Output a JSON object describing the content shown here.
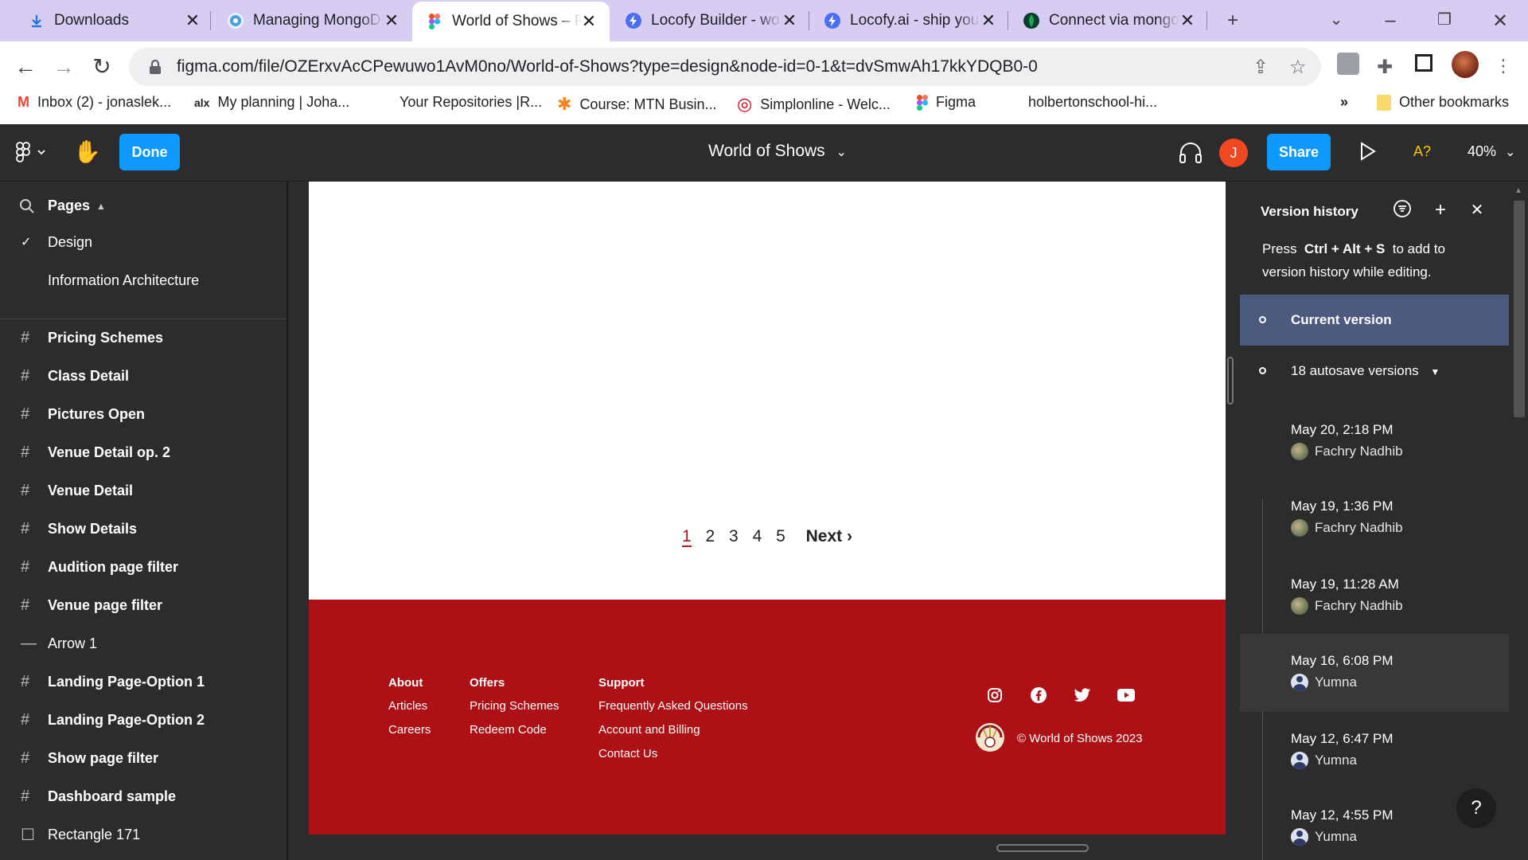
{
  "browser": {
    "tabs": [
      {
        "title": "Downloads",
        "icon": "download-icon"
      },
      {
        "title": "Managing MongoDB",
        "icon": "mongodb-atlas-icon"
      },
      {
        "title": "World of Shows – Figma",
        "icon": "figma-icon",
        "active": true
      },
      {
        "title": "Locofy Builder - wo",
        "icon": "locofy-icon"
      },
      {
        "title": "Locofy.ai - ship you",
        "icon": "locofy-icon"
      },
      {
        "title": "Connect via mongo",
        "icon": "mongodb-leaf-icon"
      }
    ],
    "new_tab": "+",
    "url": "figma.com/file/OZErxvAcCPewuwo1AvM0no/World-of-Shows?type=design&node-id=0-1&t=dvSmwAh17kkYDQB0-0",
    "bookmarks": [
      {
        "label": "Inbox (2) - jonaslek...",
        "icon": "M"
      },
      {
        "label": "My planning | Joha...",
        "icon": "alx"
      },
      {
        "label": "Your Repositories |R...",
        "icon": ""
      },
      {
        "label": "Course: MTN Busin...",
        "icon": "✱"
      },
      {
        "label": "Simplonline - Welc...",
        "icon": "◎"
      },
      {
        "label": "Figma",
        "icon": "figma"
      },
      {
        "label": "holbertonschool-hi...",
        "icon": ""
      }
    ],
    "bookmarks_overflow": "»",
    "other_bookmarks": "Other bookmarks"
  },
  "figma": {
    "done_label": "Done",
    "file_title": "World of Shows",
    "share_label": "Share",
    "avatar_initial": "J",
    "a11y_label": "A?",
    "zoom": "40%",
    "pages_label": "Pages",
    "pages": [
      {
        "label": "Design",
        "selected": true
      },
      {
        "label": "Information Architecture",
        "selected": false
      }
    ],
    "layers": [
      {
        "label": "Pricing Schemes",
        "icon": "#"
      },
      {
        "label": "Class Detail",
        "icon": "#"
      },
      {
        "label": "Pictures Open",
        "icon": "#"
      },
      {
        "label": "Venue Detail op. 2",
        "icon": "#"
      },
      {
        "label": "Venue Detail",
        "icon": "#"
      },
      {
        "label": "Show Details",
        "icon": "#"
      },
      {
        "label": "Audition page filter",
        "icon": "#"
      },
      {
        "label": "Venue page filter",
        "icon": "#"
      },
      {
        "label": "Arrow 1",
        "icon": "—"
      },
      {
        "label": "Landing Page-Option 1",
        "icon": "#"
      },
      {
        "label": "Landing Page-Option 2",
        "icon": "#"
      },
      {
        "label": "Show page filter",
        "icon": "#"
      },
      {
        "label": "Dashboard sample",
        "icon": "#"
      },
      {
        "label": "Rectangle 171",
        "icon": "☐"
      }
    ]
  },
  "canvas": {
    "pagination": {
      "pages": [
        "1",
        "2",
        "3",
        "4",
        "5"
      ],
      "current": "1",
      "next": "Next"
    },
    "footer": {
      "about": {
        "head": "About",
        "items": [
          "Articles",
          "Careers"
        ]
      },
      "offers": {
        "head": "Offers",
        "items": [
          "Pricing Schemes",
          "Redeem Code"
        ]
      },
      "support": {
        "head": "Support",
        "items": [
          "Frequently Asked Questions",
          "Account and Billing",
          "Contact Us"
        ]
      },
      "copyright": "© World of Shows 2023",
      "socials": [
        "instagram-icon",
        "facebook-icon",
        "twitter-icon",
        "youtube-icon"
      ]
    }
  },
  "version_history": {
    "title": "Version history",
    "hint_press": "Press",
    "hint_keys": "Ctrl + Alt + S",
    "hint_rest": "to add to version history while editing.",
    "current_version": "Current version",
    "autosave": "18 autosave versions",
    "versions": [
      {
        "date": "May 20, 2:18 PM",
        "author": "Fachry Nadhib",
        "avatar": "photo"
      },
      {
        "date": "May 19, 1:36 PM",
        "author": "Fachry Nadhib",
        "avatar": "photo"
      },
      {
        "date": "May 19, 11:28 AM",
        "author": "Fachry Nadhib",
        "avatar": "photo"
      },
      {
        "date": "May 16, 6:08 PM",
        "author": "Yumna",
        "avatar": "user"
      },
      {
        "date": "May 12, 6:47 PM",
        "author": "Yumna",
        "avatar": "user"
      },
      {
        "date": "May 12, 4:55 PM",
        "author": "Yumna",
        "avatar": "user"
      }
    ],
    "help": "?"
  },
  "colors": {
    "accent": "#0d99ff",
    "footer_red": "#ad1015",
    "selected_version": "#4c5a7f",
    "tabstrip": "#d7cdf2"
  }
}
